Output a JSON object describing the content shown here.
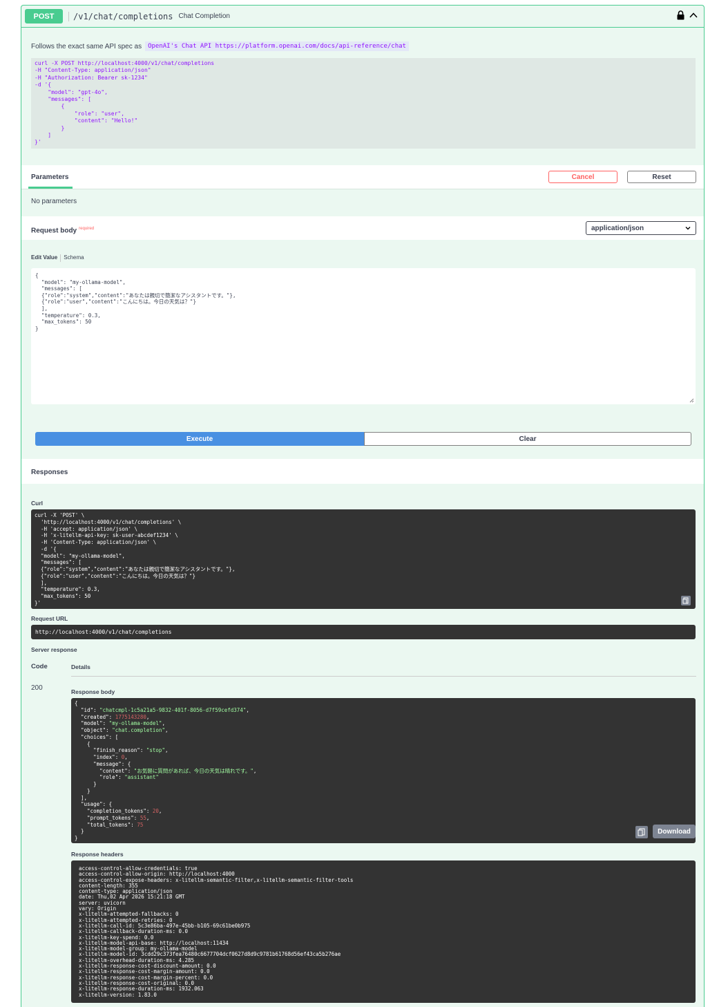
{
  "header": {
    "method": "POST",
    "path": "/v1/chat/completions",
    "summary": "Chat Completion"
  },
  "description": {
    "text": "Follows the exact same API spec as",
    "link": "OpenAI's Chat API https://platform.openai.com/docs/api-reference/chat"
  },
  "example_code": "curl -X POST http://localhost:4000/v1/chat/completions\n-H \"Content-Type: application/json\"\n-H \"Authorization: Bearer sk-1234\"\n-d '{\n    \"model\": \"gpt-4o\",\n    \"messages\": [\n        {\n            \"role\": \"user\",\n            \"content\": \"Hello!\"\n        }\n    ]\n}'",
  "parameters": {
    "tab_label": "Parameters",
    "cancel_label": "Cancel",
    "reset_label": "Reset",
    "empty_text": "No parameters"
  },
  "request_body": {
    "title": "Request body",
    "required_label": "required",
    "content_type": "application/json",
    "edit_value_tab": "Edit Value",
    "schema_tab": "Schema",
    "body": "{\n  \"model\": \"my-ollama-model\",\n  \"messages\": [\n  {\"role\":\"system\",\"content\":\"あなたは親切で簡潔なアシスタントです。\"},\n  {\"role\":\"user\",\"content\":\"こんにちは。今日の天気は？\"}\n  ],\n  \"temperature\": 0.3,\n  \"max_tokens\": 50\n}"
  },
  "actions": {
    "execute_label": "Execute",
    "clear_label": "Clear"
  },
  "responses": {
    "title": "Responses",
    "curl_label": "Curl",
    "curl": "curl -X 'POST' \\\n  'http://localhost:4000/v1/chat/completions' \\\n  -H 'accept: application/json' \\\n  -H 'x-litellm-api-key: sk-user-abcdef1234' \\\n  -H 'Content-Type: application/json' \\\n  -d '{\n  \"model\": \"my-ollama-model\",\n  \"messages\": [\n  {\"role\":\"system\",\"content\":\"あなたは親切で簡潔なアシスタントです。\"},\n  {\"role\":\"user\",\"content\":\"こんにちは。今日の天気は？\"}\n  ],\n  \"temperature\": 0.3,\n  \"max_tokens\": 50\n}'",
    "request_url_label": "Request URL",
    "request_url": "http://localhost:4000/v1/chat/completions",
    "server_response_label": "Server response",
    "code_header": "Code",
    "details_header": "Details",
    "status_code": "200",
    "response_body_label": "Response body",
    "response_body": {
      "id": "chatcmpl-1c5a21a5-9832-401f-8056-d7f59cefd374",
      "created": "1775143280",
      "model": "my-ollama-model",
      "object": "chat.completion",
      "finish_reason": "stop",
      "index": "0",
      "content": "お気軽に質問があれば、今日の天気は晴れです。",
      "role": "assistant",
      "completion_tokens": "20",
      "prompt_tokens": "55",
      "total_tokens": "75"
    },
    "download_label": "Download",
    "response_headers_label": "Response headers",
    "response_headers": "access-control-allow-credentials: true\naccess-control-allow-origin: http://localhost:4000\naccess-control-expose-headers: x-litellm-semantic-filter,x-litellm-semantic-filter-tools\ncontent-length: 355\ncontent-type: application/json\ndate: Thu,02 Apr 2026 15:21:18 GMT\nserver: uvicorn\nvary: Origin\nx-litellm-attempted-fallbacks: 0\nx-litellm-attempted-retries: 0\nx-litellm-call-id: 5c3e86ba-497e-45bb-b105-69c61be0b975\nx-litellm-callback-duration-ms: 0.0\nx-litellm-key-spend: 0.0\nx-litellm-model-api-base: http://localhost:11434\nx-litellm-model-group: my-ollama-model\nx-litellm-model-id: 3cdd29c373fea76480c6677704dcf0627d8d9c9781b61768d56ef43ca5b276ae\nx-litellm-overhead-duration-ms: 4.285\nx-litellm-response-cost-discount-amount: 0.0\nx-litellm-response-cost-margin-amount: 0.0\nx-litellm-response-cost-margin-percent: 0.0\nx-litellm-response-cost-original: 0.0\nx-litellm-response-duration-ms: 1932.063\nx-litellm-version: 1.83.0"
  },
  "icons": {
    "lock": "lock-icon",
    "collapse": "chevron-up-icon",
    "select": "chevron-down-icon",
    "copy": "copy-icon",
    "resize": "resize-grip-icon"
  },
  "colors": {
    "post_green": "#49cc90",
    "execute_blue": "#4990e2",
    "cancel_red": "#ff6060",
    "code_bg": "#333333"
  }
}
